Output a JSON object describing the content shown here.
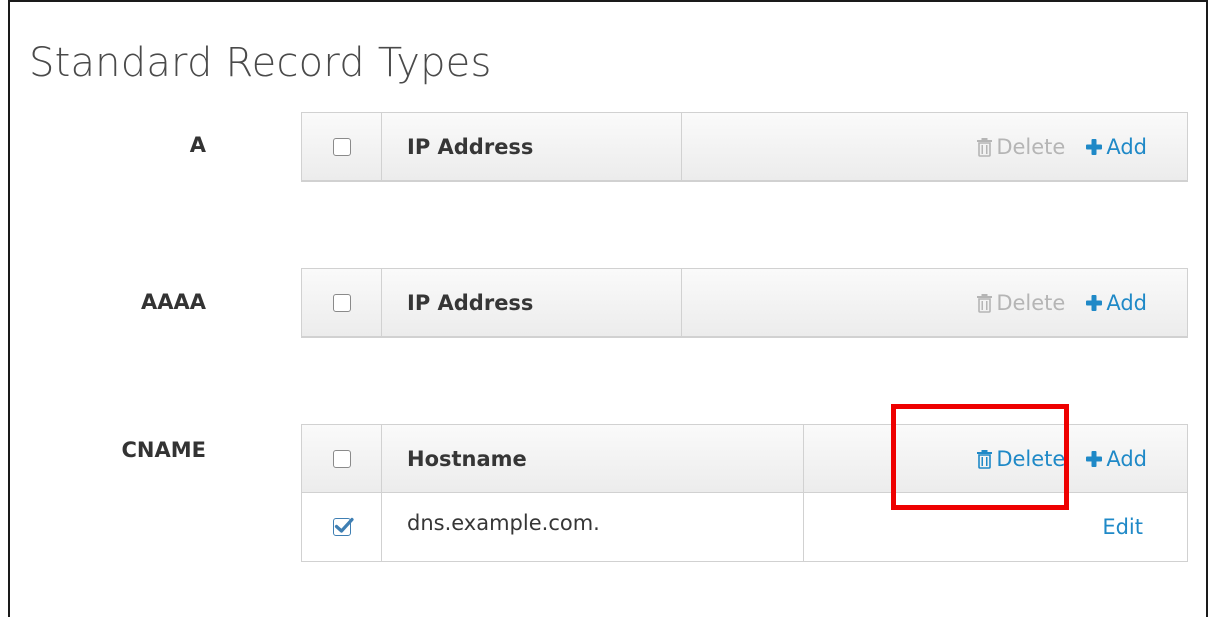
{
  "page": {
    "title": "Standard Record Types"
  },
  "colors": {
    "link": "#1f89c7",
    "disabled": "#b5b5b5",
    "highlight": "#ee0000",
    "checkbox_checked": "#3f7fb3"
  },
  "records": [
    {
      "type": "A",
      "column": "IP Address",
      "delete_label": "Delete",
      "delete_enabled": false,
      "add_label": "Add",
      "rows": []
    },
    {
      "type": "AAAA",
      "column": "IP Address",
      "delete_label": "Delete",
      "delete_enabled": false,
      "add_label": "Add",
      "rows": []
    },
    {
      "type": "CNAME",
      "column": "Hostname",
      "delete_label": "Delete",
      "delete_enabled": true,
      "add_label": "Add",
      "rows": [
        {
          "value": "dns.example.com.",
          "checked": true,
          "edit_label": "Edit"
        }
      ]
    }
  ],
  "icons": {
    "delete": "trash-icon",
    "add": "plus-icon",
    "checked": "check-icon"
  }
}
